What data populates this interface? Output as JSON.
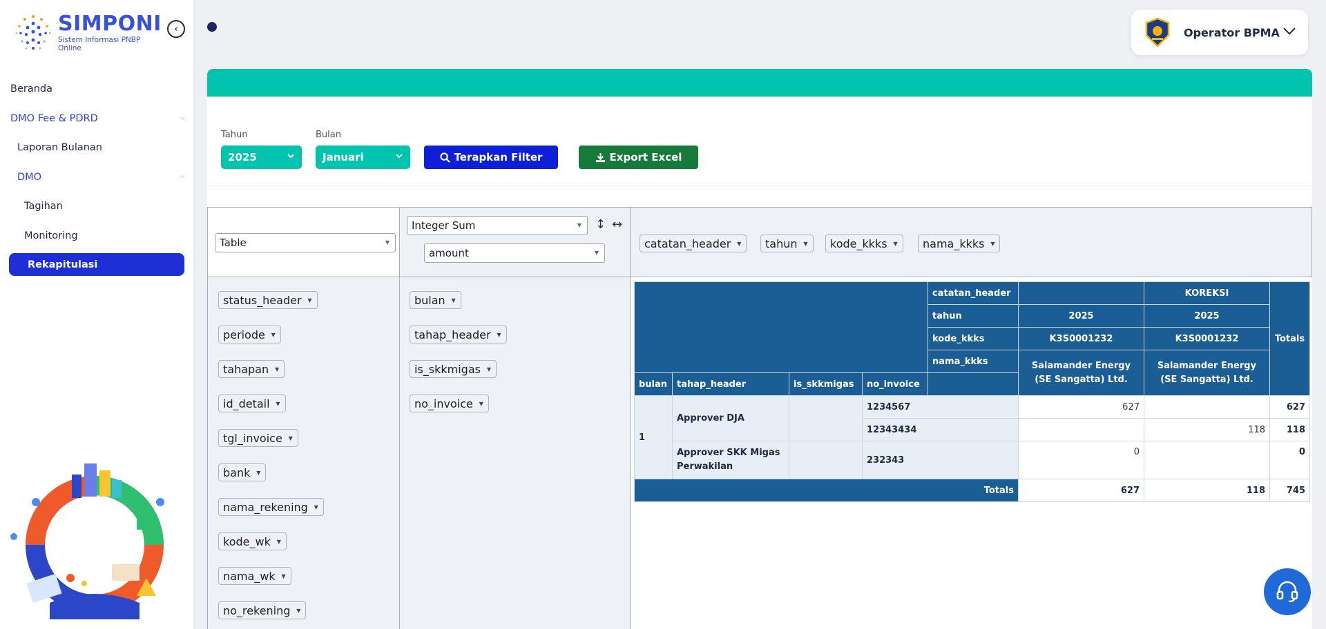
{
  "app": {
    "title": "SIMPONI",
    "subtitle": "Sistem Informasi PNBP Online"
  },
  "sidebar": {
    "items": [
      {
        "label": "Beranda"
      },
      {
        "label": "DMO Fee & PDRD"
      },
      {
        "label": "Laporan Bulanan"
      },
      {
        "label": "DMO"
      },
      {
        "label": "Tagihan"
      },
      {
        "label": "Monitoring"
      },
      {
        "label": "Rekapitulasi"
      }
    ]
  },
  "user": {
    "name": "Operator BPMA"
  },
  "filters": {
    "tahun_label": "Tahun",
    "tahun_value": "2025",
    "bulan_label": "Bulan",
    "bulan_value": "Januari",
    "apply_label": "Terapkan Filter",
    "export_label": "Export Excel"
  },
  "pivot": {
    "renderer": "Table",
    "aggregator": "Integer Sum",
    "aggregator_field": "amount",
    "column_fields": [
      "catatan_header",
      "tahun",
      "kode_kkks",
      "nama_kkks"
    ],
    "unused_fields": [
      "status_header",
      "periode",
      "tahapan",
      "id_detail",
      "tgl_invoice",
      "bank",
      "nama_rekening",
      "kode_wk",
      "nama_wk",
      "no_rekening"
    ],
    "row_fields": [
      "bulan",
      "tahap_header",
      "is_skkmigas",
      "no_invoice"
    ],
    "table": {
      "col_attr_labels": [
        "catatan_header",
        "tahun",
        "kode_kkks",
        "nama_kkks"
      ],
      "col_keys": [
        {
          "catatan_header": "",
          "tahun": "2025",
          "kode_kkks": "K3S0001232",
          "nama_kkks": "Salamander Energy (SE Sangatta) Ltd."
        },
        {
          "catatan_header": "KOREKSI",
          "tahun": "2025",
          "kode_kkks": "K3S0001232",
          "nama_kkks": "Salamander Energy (SE Sangatta) Ltd."
        }
      ],
      "totals_label": "Totals",
      "row_attr_labels": [
        "bulan",
        "tahap_header",
        "is_skkmigas",
        "no_invoice"
      ],
      "rows": [
        {
          "bulan": "1",
          "tahap_header": "Approver DJA",
          "is_skkmigas": "",
          "no_invoice": "1234567",
          "values": [
            "627",
            ""
          ],
          "total": "627"
        },
        {
          "no_invoice": "12343434",
          "values": [
            "",
            "118"
          ],
          "total": "118"
        },
        {
          "tahap_header": "Approver SKK Migas Perwakilan",
          "is_skkmigas": "",
          "no_invoice": "232343",
          "values": [
            "0",
            ""
          ],
          "total": "0"
        }
      ],
      "col_totals": [
        "627",
        "118"
      ],
      "grand_total": "745"
    }
  }
}
